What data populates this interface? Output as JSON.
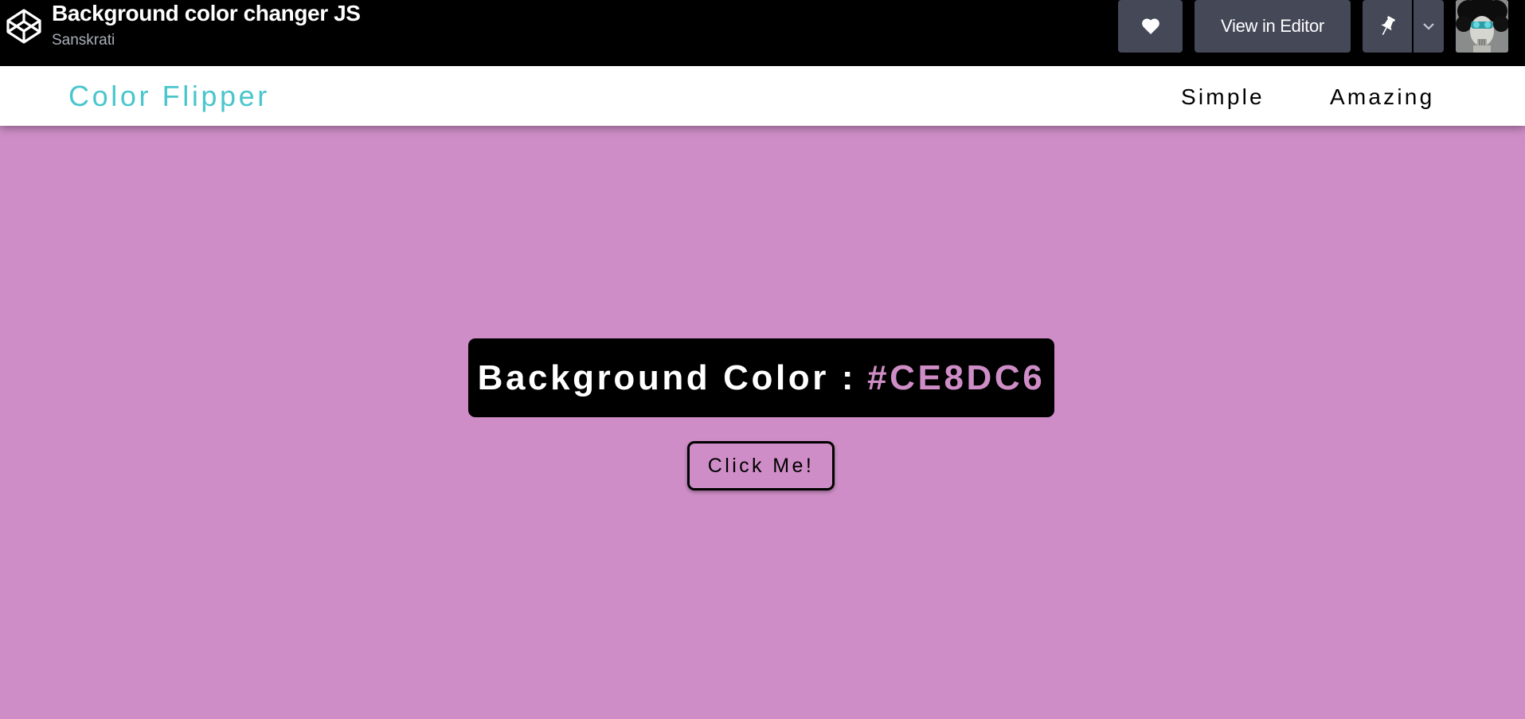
{
  "codepen": {
    "title": "Background color changer JS",
    "author": "Sanskrati",
    "view_in_editor_label": "View in Editor",
    "icons": {
      "logo": "codepen-logo-icon",
      "like": "heart-icon",
      "pin": "pin-icon",
      "pin_menu": "chevron-down-icon"
    },
    "colors": {
      "bar": "#000000",
      "button": "#444857",
      "author_text": "#aaaeb8"
    }
  },
  "app": {
    "brand": "Color Flipper",
    "nav": {
      "simple": "Simple",
      "amazing": "Amazing"
    },
    "color_display": {
      "label": "Background Color",
      "separator": ":",
      "value": "#CE8DC6"
    },
    "button_label": "Click Me!",
    "colors": {
      "background": "#CE8DC6",
      "brand": "#49C6CC",
      "panel": "#000000"
    }
  }
}
